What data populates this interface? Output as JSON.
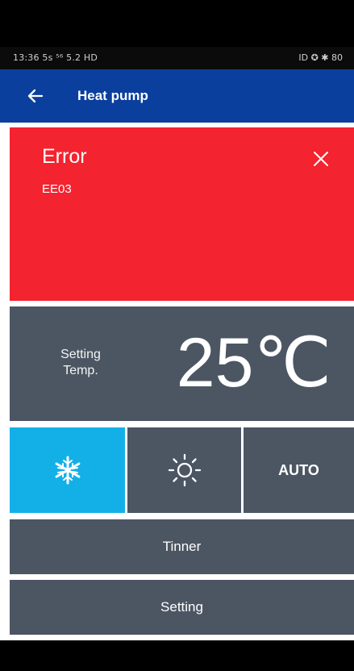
{
  "status_bar": {
    "left_text": "13:36 5s ⁵⁶ 5.2 HD",
    "right_text": "ID ✪ ✱ 80"
  },
  "app_bar": {
    "back_icon": "arrow-left-icon",
    "title": "Heat pump"
  },
  "error": {
    "title": "Error",
    "code": "EE03",
    "close_icon": "close-icon",
    "background": "#f3232f"
  },
  "setting": {
    "label_line1": "Setting",
    "label_line2": "Temp.",
    "value": "25℃"
  },
  "modes": [
    {
      "name": "cool",
      "icon": "snowflake-icon",
      "selected": true,
      "color": "#13b0e8"
    },
    {
      "name": "heat",
      "icon": "sun-icon",
      "selected": false
    },
    {
      "name": "auto",
      "label": "AUTO",
      "selected": false
    }
  ],
  "buttons": {
    "timer": "Tinner",
    "setting": "Setting"
  },
  "colors": {
    "app_bar": "#0b3f9e",
    "panel": "#4c5663"
  }
}
